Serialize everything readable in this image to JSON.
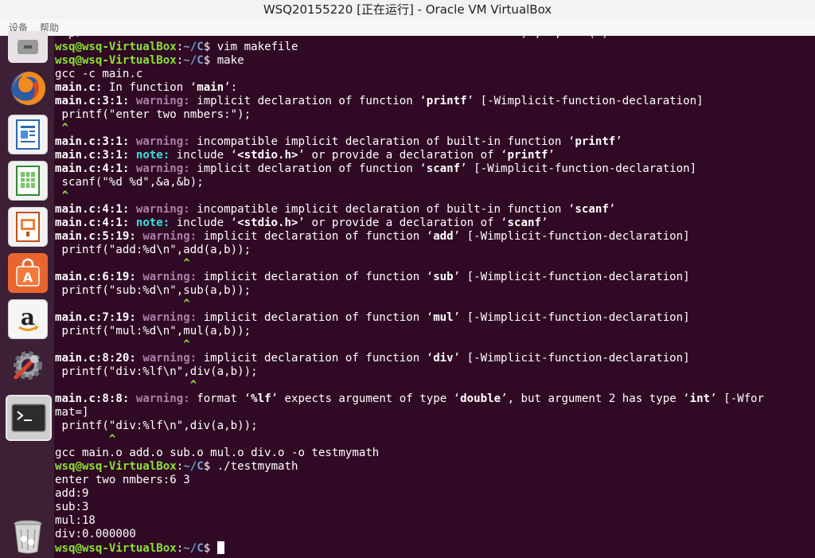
{
  "window": {
    "title": "WSQ20155220 [正在运行] - Oracle VM VirtualBox",
    "menu": [
      "设备",
      "帮助"
    ]
  },
  "launcher": {
    "items": [
      "disk-icon",
      "firefox-icon",
      "libreoffice-writer-icon",
      "libreoffice-calc-icon",
      "libreoffice-impress-icon",
      "ubuntu-software-icon",
      "amazon-icon",
      "system-settings-icon",
      "terminal-icon",
      "trash-icon"
    ]
  },
  "colors": {
    "terminal_bg": "#300a24",
    "launcher_bg": "#3d1f36",
    "prompt_user": "#8ae234",
    "prompt_path": "#729fcf",
    "warning": "#ad7fa8",
    "note": "#34e2e2"
  },
  "terminal": {
    "prompt_user": "wsq@wsq-VirtualBox",
    "prompt_colon": ":",
    "prompt_path": "~/C",
    "prompt_dollar": "$ ",
    "lines": [
      {
        "type": "plain",
        "text": "  pr                                                                 ) ,  ,    ( )"
      },
      {
        "type": "prompt",
        "cmd": "vim makefile"
      },
      {
        "type": "prompt",
        "cmd": "make"
      },
      {
        "type": "plain",
        "text": "gcc -c main.c"
      },
      {
        "type": "diag",
        "segs": [
          {
            "c": "b",
            "t": "main.c:"
          },
          {
            "c": "",
            "t": " In function ‘"
          },
          {
            "c": "b",
            "t": "main"
          },
          {
            "c": "",
            "t": "’:"
          }
        ]
      },
      {
        "type": "diag",
        "segs": [
          {
            "c": "b",
            "t": "main.c:3:1: "
          },
          {
            "c": "warn",
            "t": "warning: "
          },
          {
            "c": "",
            "t": "implicit declaration of function ‘"
          },
          {
            "c": "b",
            "t": "printf"
          },
          {
            "c": "",
            "t": "’ [-Wimplicit-function-declaration]"
          }
        ]
      },
      {
        "type": "plain",
        "text": " printf(\"enter two nmbers:\");"
      },
      {
        "type": "caret",
        "text": " ^"
      },
      {
        "type": "diag",
        "segs": [
          {
            "c": "b",
            "t": "main.c:3:1: "
          },
          {
            "c": "warn",
            "t": "warning: "
          },
          {
            "c": "",
            "t": "incompatible implicit declaration of built-in function ‘"
          },
          {
            "c": "b",
            "t": "printf"
          },
          {
            "c": "",
            "t": "’"
          }
        ]
      },
      {
        "type": "diag",
        "segs": [
          {
            "c": "b",
            "t": "main.c:3:1: "
          },
          {
            "c": "note",
            "t": "note: "
          },
          {
            "c": "",
            "t": "include ‘"
          },
          {
            "c": "b",
            "t": "<stdio.h>"
          },
          {
            "c": "",
            "t": "’ or provide a declaration of ‘"
          },
          {
            "c": "b",
            "t": "printf"
          },
          {
            "c": "",
            "t": "’"
          }
        ]
      },
      {
        "type": "diag",
        "segs": [
          {
            "c": "b",
            "t": "main.c:4:1: "
          },
          {
            "c": "warn",
            "t": "warning: "
          },
          {
            "c": "",
            "t": "implicit declaration of function ‘"
          },
          {
            "c": "b",
            "t": "scanf"
          },
          {
            "c": "",
            "t": "’ [-Wimplicit-function-declaration]"
          }
        ]
      },
      {
        "type": "plain",
        "text": " scanf(\"%d %d\",&a,&b);"
      },
      {
        "type": "caret",
        "text": " ^"
      },
      {
        "type": "diag",
        "segs": [
          {
            "c": "b",
            "t": "main.c:4:1: "
          },
          {
            "c": "warn",
            "t": "warning: "
          },
          {
            "c": "",
            "t": "incompatible implicit declaration of built-in function ‘"
          },
          {
            "c": "b",
            "t": "scanf"
          },
          {
            "c": "",
            "t": "’"
          }
        ]
      },
      {
        "type": "diag",
        "segs": [
          {
            "c": "b",
            "t": "main.c:4:1: "
          },
          {
            "c": "note",
            "t": "note: "
          },
          {
            "c": "",
            "t": "include ‘"
          },
          {
            "c": "b",
            "t": "<stdio.h>"
          },
          {
            "c": "",
            "t": "’ or provide a declaration of ‘"
          },
          {
            "c": "b",
            "t": "scanf"
          },
          {
            "c": "",
            "t": "’"
          }
        ]
      },
      {
        "type": "diag",
        "segs": [
          {
            "c": "b",
            "t": "main.c:5:19: "
          },
          {
            "c": "warn",
            "t": "warning: "
          },
          {
            "c": "",
            "t": "implicit declaration of function ‘"
          },
          {
            "c": "b",
            "t": "add"
          },
          {
            "c": "",
            "t": "’ [-Wimplicit-function-declaration]"
          }
        ]
      },
      {
        "type": "plain",
        "text": " printf(\"add:%d\\n\",add(a,b));"
      },
      {
        "type": "caret",
        "text": "                   ^"
      },
      {
        "type": "diag",
        "segs": [
          {
            "c": "b",
            "t": "main.c:6:19: "
          },
          {
            "c": "warn",
            "t": "warning: "
          },
          {
            "c": "",
            "t": "implicit declaration of function ‘"
          },
          {
            "c": "b",
            "t": "sub"
          },
          {
            "c": "",
            "t": "’ [-Wimplicit-function-declaration]"
          }
        ]
      },
      {
        "type": "plain",
        "text": " printf(\"sub:%d\\n\",sub(a,b));"
      },
      {
        "type": "caret",
        "text": "                   ^"
      },
      {
        "type": "diag",
        "segs": [
          {
            "c": "b",
            "t": "main.c:7:19: "
          },
          {
            "c": "warn",
            "t": "warning: "
          },
          {
            "c": "",
            "t": "implicit declaration of function ‘"
          },
          {
            "c": "b",
            "t": "mul"
          },
          {
            "c": "",
            "t": "’ [-Wimplicit-function-declaration]"
          }
        ]
      },
      {
        "type": "plain",
        "text": " printf(\"mul:%d\\n\",mul(a,b));"
      },
      {
        "type": "caret",
        "text": "                   ^"
      },
      {
        "type": "diag",
        "segs": [
          {
            "c": "b",
            "t": "main.c:8:20: "
          },
          {
            "c": "warn",
            "t": "warning: "
          },
          {
            "c": "",
            "t": "implicit declaration of function ‘"
          },
          {
            "c": "b",
            "t": "div"
          },
          {
            "c": "",
            "t": "’ [-Wimplicit-function-declaration]"
          }
        ]
      },
      {
        "type": "plain",
        "text": " printf(\"div:%lf\\n\",div(a,b));"
      },
      {
        "type": "caret",
        "text": "                    ^"
      },
      {
        "type": "diag",
        "segs": [
          {
            "c": "b",
            "t": "main.c:8:8: "
          },
          {
            "c": "warn",
            "t": "warning: "
          },
          {
            "c": "",
            "t": "format ‘"
          },
          {
            "c": "b",
            "t": "%lf"
          },
          {
            "c": "",
            "t": "’ expects argument of type ‘"
          },
          {
            "c": "b",
            "t": "double"
          },
          {
            "c": "",
            "t": "’, but argument 2 has type ‘"
          },
          {
            "c": "b",
            "t": "int"
          },
          {
            "c": "",
            "t": "’ [-Wfor"
          }
        ]
      },
      {
        "type": "plain",
        "text": "mat=]"
      },
      {
        "type": "plain",
        "text": " printf(\"div:%lf\\n\",div(a,b));"
      },
      {
        "type": "caret",
        "text": "        ^"
      },
      {
        "type": "plain",
        "text": "gcc main.o add.o sub.o mul.o div.o -o testmymath"
      },
      {
        "type": "prompt",
        "cmd": "./testmymath"
      },
      {
        "type": "plain",
        "text": "enter two nmbers:6 3"
      },
      {
        "type": "plain",
        "text": "add:9"
      },
      {
        "type": "plain",
        "text": "sub:3"
      },
      {
        "type": "plain",
        "text": "mul:18"
      },
      {
        "type": "plain",
        "text": "div:0.000000"
      },
      {
        "type": "prompt",
        "cmd": "",
        "cursor": true
      }
    ]
  }
}
